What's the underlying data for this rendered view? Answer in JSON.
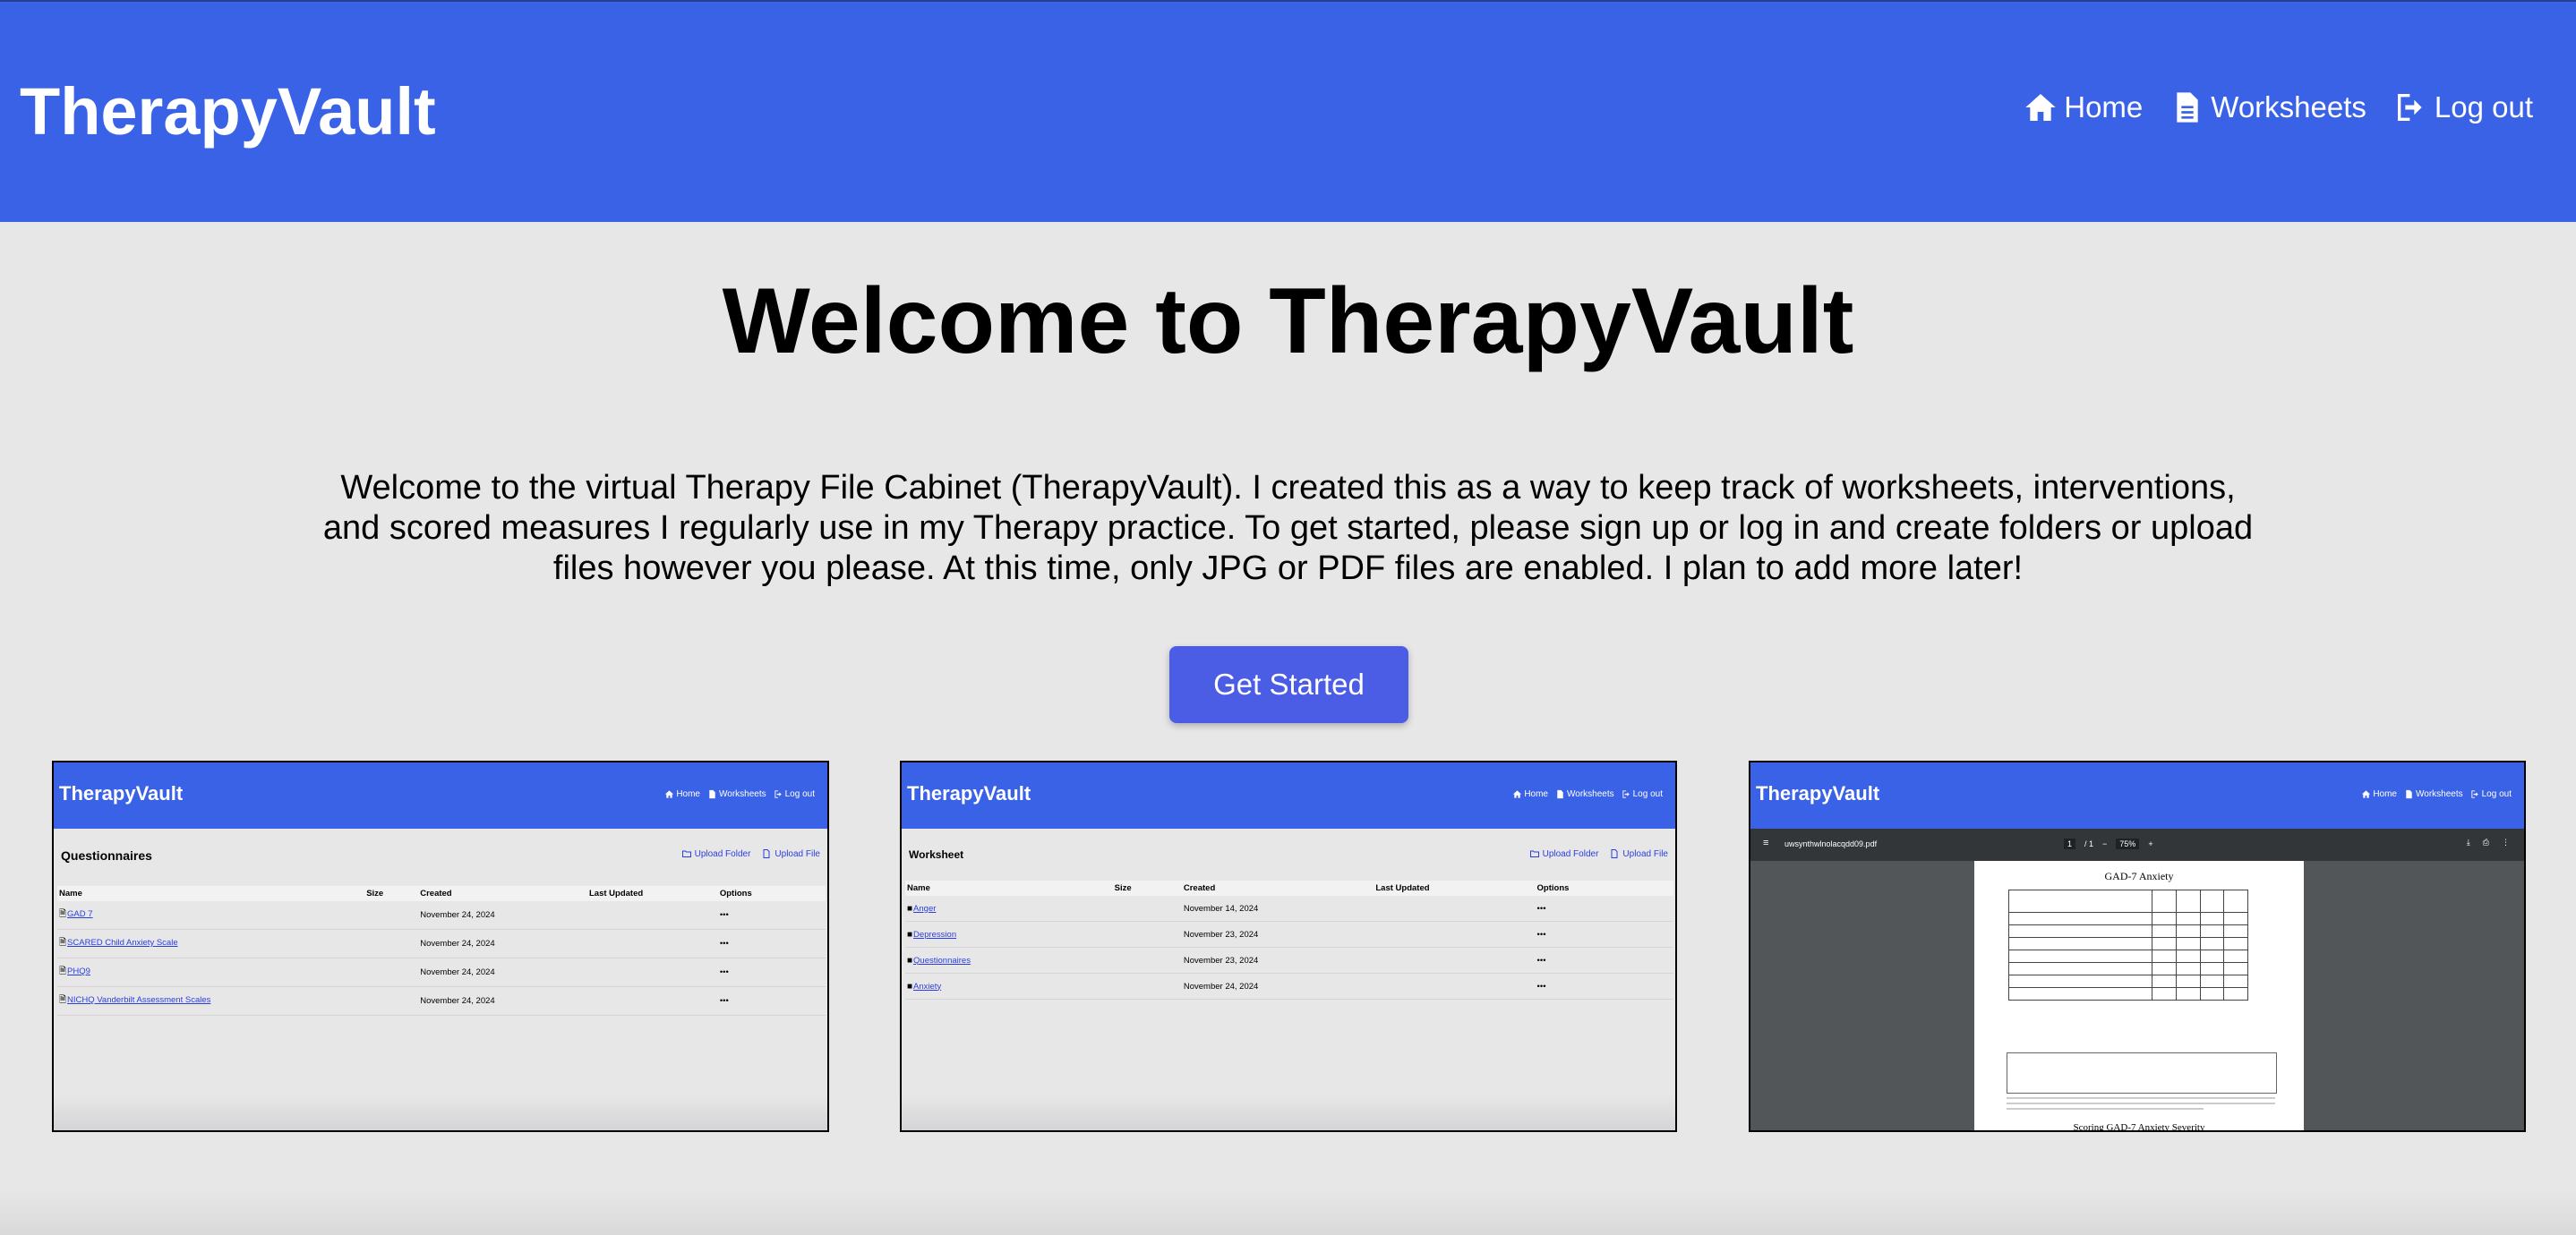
{
  "header": {
    "brand": "TherapyVault",
    "nav": [
      {
        "label": "Home",
        "icon": "home-icon"
      },
      {
        "label": "Worksheets",
        "icon": "file-icon"
      },
      {
        "label": "Log out",
        "icon": "logout-icon"
      }
    ]
  },
  "main": {
    "title": "Welcome to TherapyVault",
    "intro": "Welcome to the virtual Therapy File Cabinet (TherapyVault). I created this as a way to keep track of worksheets, interventions, and scored measures I regularly use in my Therapy practice. To get started, please sign up or log in and create folders or upload files however you please. At this time, only JPG or PDF files are enabled. I plan to add more later!",
    "cta_label": "Get Started"
  },
  "screenshots": {
    "questionnaires": {
      "brand": "TherapyVault",
      "nav": [
        "Home",
        "Worksheets",
        "Log out"
      ],
      "heading": "Questionnaires",
      "actions": [
        "Upload Folder",
        "Upload File"
      ],
      "columns": [
        "Name",
        "Size",
        "Created",
        "Last Updated",
        "Options"
      ],
      "rows": [
        {
          "name": "GAD 7",
          "created": "November 24, 2024",
          "options": "•••"
        },
        {
          "name": "SCARED Child Anxiety Scale",
          "created": "November 24, 2024",
          "options": "•••"
        },
        {
          "name": "PHQ9",
          "created": "November 24, 2024",
          "options": "•••"
        },
        {
          "name": "NICHQ Vanderbilt Assessment Scales",
          "created": "November 24, 2024",
          "options": "•••"
        }
      ]
    },
    "worksheet": {
      "brand": "TherapyVault",
      "nav": [
        "Home",
        "Worksheets",
        "Log out"
      ],
      "heading": "Worksheet",
      "actions": [
        "Upload Folder",
        "Upload File"
      ],
      "columns": [
        "Name",
        "Size",
        "Created",
        "Last Updated",
        "Options"
      ],
      "rows": [
        {
          "name": "Anger",
          "created": "November 14, 2024",
          "options": "•••"
        },
        {
          "name": "Depression",
          "created": "November 23, 2024",
          "options": "•••"
        },
        {
          "name": "Questionnaires",
          "created": "November 23, 2024",
          "options": "•••"
        },
        {
          "name": "Anxiety",
          "created": "November 24, 2024",
          "options": "•••"
        }
      ]
    },
    "pdf": {
      "brand": "TherapyVault",
      "nav": [
        "Home",
        "Worksheets",
        "Log out"
      ],
      "filename": "uwsynthwlnolacqdd09.pdf",
      "page": "1",
      "page_total": "/ 1",
      "zoom": "75%",
      "doc_title": "GAD-7 Anxiety",
      "doc_subtitle": "Scoring GAD-7 Anxiety Severity"
    }
  }
}
